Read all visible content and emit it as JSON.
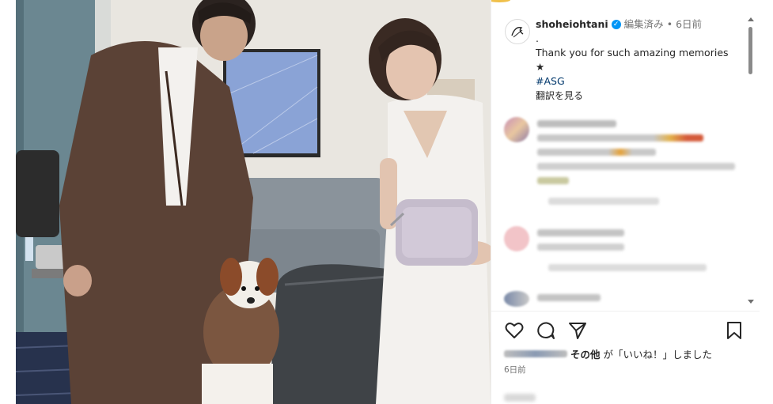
{
  "post": {
    "username": "shoheiohtani",
    "edited": "編集済み",
    "separator": "•",
    "time_ago": "6日前",
    "caption_lines": [
      ".",
      "Thank you for such amazing memories",
      "★"
    ],
    "hashtag": "#ASG",
    "translate": "翻訳を見る",
    "verified_glyph": "✓"
  },
  "likes": {
    "others": "その他",
    "suffix": "が「いいね！」しました"
  },
  "footer": {
    "date": "6日前"
  },
  "icons": [
    "avatar-logo",
    "verified-badge-icon",
    "heart-icon",
    "comment-icon",
    "share-icon",
    "bookmark-icon",
    "scroll-up-icon",
    "scroll-down-icon"
  ],
  "colors": {
    "accent": "#0095f6",
    "hashtag": "#00376b",
    "muted": "#737373",
    "text": "#262626"
  }
}
